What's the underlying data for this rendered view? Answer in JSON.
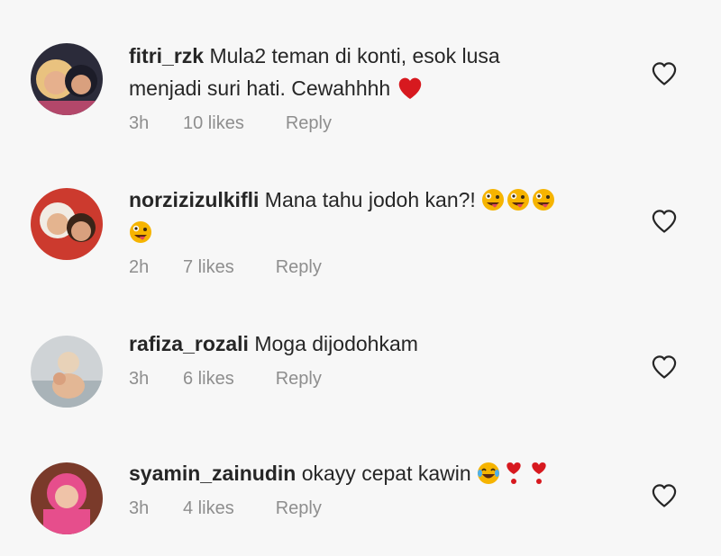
{
  "comments": [
    {
      "username": "fitri_rzk",
      "text_line1": "Mula2 teman di konti, esok lusa",
      "text_line2": "menjadi suri hati. Cewahhhh",
      "time": "3h",
      "likes": "10 likes",
      "reply": "Reply",
      "emoji": [
        "red-heart-icon"
      ]
    },
    {
      "username": "norzizizulkifli",
      "text_line1": "Mana tahu jodoh kan?!",
      "time": "2h",
      "likes": "7 likes",
      "reply": "Reply",
      "emoji": [
        "zany-face-icon",
        "zany-face-icon",
        "zany-face-icon",
        "zany-face-icon"
      ]
    },
    {
      "username": "rafiza_rozali",
      "text_line1": "Moga dijodohkam",
      "time": "3h",
      "likes": "6 likes",
      "reply": "Reply"
    },
    {
      "username": "syamin_zainudin",
      "text_line1": "okayy cepat kawin",
      "time": "3h",
      "likes": "4 likes",
      "reply": "Reply",
      "emoji": [
        "tears-of-joy-face-icon",
        "heart-exclamation-icon",
        "heart-exclamation-icon"
      ]
    }
  ],
  "colors": {
    "text": "#262626",
    "meta": "#8e8e8e",
    "heart": "#d7191f",
    "emoji_face": "#f6b400"
  }
}
